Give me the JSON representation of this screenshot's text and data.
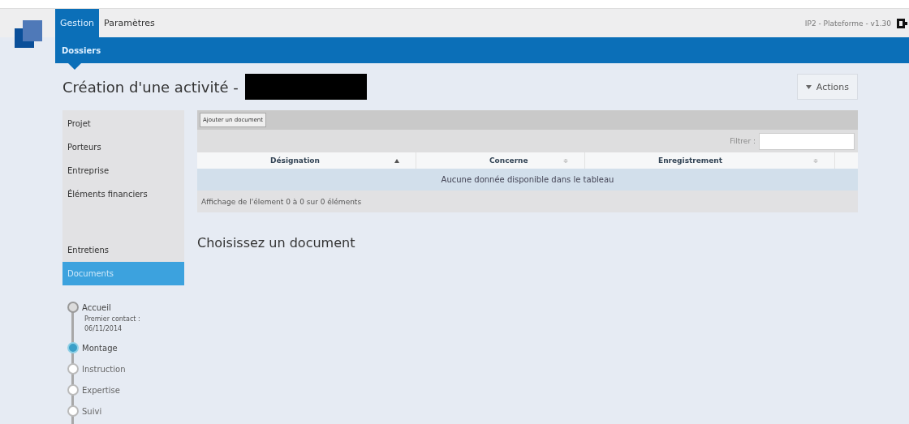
{
  "top_tabs": [
    {
      "label": "Gestion",
      "selected": true
    },
    {
      "label": "Paramètres",
      "selected": false
    }
  ],
  "version": "IP2 - Plateforme - v1.30",
  "sub_tabs": [
    {
      "label": "Dossiers",
      "selected": true
    }
  ],
  "page_title": "Création d'une activité -",
  "actions_button": "Actions",
  "sidebar": {
    "items": [
      {
        "label": "Projet",
        "selected": false
      },
      {
        "label": "Porteurs",
        "selected": false
      },
      {
        "label": "Entreprise",
        "selected": false
      },
      {
        "label": "Éléments financiers",
        "selected": false
      },
      {
        "label": "Entretiens",
        "selected": false
      },
      {
        "label": "Documents",
        "selected": true
      }
    ]
  },
  "steps": [
    {
      "label": "Accueil",
      "completed": true,
      "selected": false,
      "note": "Premier contact :",
      "date": "06/11/2014"
    },
    {
      "label": "Montage",
      "completed": false,
      "selected": true
    },
    {
      "label": "Instruction",
      "completed": false,
      "selected": false
    },
    {
      "label": "Expertise",
      "completed": false,
      "selected": false
    },
    {
      "label": "Suivi",
      "completed": false,
      "selected": false
    }
  ],
  "add_button": "Ajouter un document",
  "filter_label": "Filtrer :",
  "table": {
    "columns": [
      {
        "label": "Désignation",
        "sorted": true
      },
      {
        "label": "Concerne",
        "sorted": false
      },
      {
        "label": "Enregistrement",
        "sorted": false
      }
    ],
    "empty": "Aucune donnée disponible dans le tableau",
    "info": "Affichage de l'élement 0 à 0 sur 0 éléments"
  },
  "section_title": "Choisissez un document"
}
